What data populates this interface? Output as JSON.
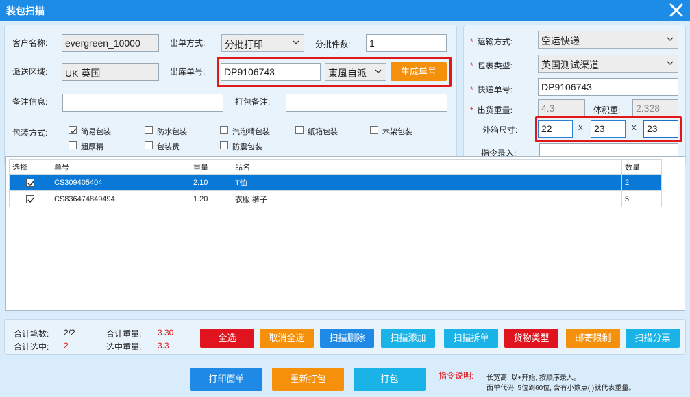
{
  "window": {
    "title": "装包扫描",
    "close_icon": "close-icon"
  },
  "form": {
    "customer_label": "客户名称:",
    "customer_value": "evergreen_10000",
    "order_method_label": "出单方式:",
    "order_method_value": "分批打印",
    "batch_count_label": "分批件数:",
    "batch_count_value": "1",
    "delivery_area_label": "派送区域:",
    "delivery_area_value": "UK 英国",
    "outbound_no_label": "出库单号:",
    "outbound_no_value": "DP9106743",
    "outbound_channel_value": "東風自派",
    "generate_button": "生成单号",
    "remark_label": "备注信息:",
    "remark_value": "",
    "pack_remark_label": "打包备注:",
    "pack_remark_value": "",
    "packing_label": "包装方式:",
    "packing_options": [
      {
        "label": "简易包装",
        "checked": true
      },
      {
        "label": "防水包装",
        "checked": false
      },
      {
        "label": "汽泡精包装",
        "checked": false
      },
      {
        "label": "纸箱包装",
        "checked": false
      },
      {
        "label": "木架包装",
        "checked": false
      },
      {
        "label": "超厚精",
        "checked": false
      },
      {
        "label": "包装费",
        "checked": false
      },
      {
        "label": "防震包装",
        "checked": false
      }
    ]
  },
  "shipping": {
    "required_mark": "*",
    "transport_label": "运输方式:",
    "transport_value": "空运快递",
    "package_type_label": "包裹类型:",
    "package_type_value": "英国测试渠道",
    "tracking_label": "快递单号:",
    "tracking_value": "DP9106743",
    "weight_label": "出货重量:",
    "weight_value": "4.3",
    "volume_weight_label": "体积重:",
    "volume_weight_value": "2.328",
    "dimensions_label": "外箱尺寸:",
    "dim_length": "22",
    "dim_width": "23",
    "dim_height": "23",
    "dim_sep": "X",
    "command_label": "指令录入:",
    "command_value": ""
  },
  "table": {
    "headers": [
      "选择",
      "单号",
      "重量",
      "品名",
      "数量"
    ],
    "rows": [
      {
        "checked": true,
        "order_no": "CS309405404",
        "weight": "2.10",
        "name": "T恤",
        "qty": "2",
        "selected": true
      },
      {
        "checked": true,
        "order_no": "CS836474849494",
        "weight": "1.20",
        "name": "衣服,裤子",
        "qty": "5",
        "selected": false
      }
    ]
  },
  "summary": {
    "total_count_label": "合计笔数:",
    "total_count_value": "2/2",
    "total_weight_label": "合计重量:",
    "total_weight_value": "3.30",
    "selected_count_label": "合计选中:",
    "selected_count_value": "2",
    "selected_weight_label": "选中重量:",
    "selected_weight_value": "3.3"
  },
  "actions": {
    "select_all": "全选",
    "deselect_all": "取消全选",
    "scan_delete": "扫描删除",
    "scan_add": "扫描添加",
    "scan_split": "扫描拆单",
    "goods_type": "货物类型",
    "postal_limit": "邮寄限制",
    "scan_split_ticket": "扫描分票"
  },
  "footer": {
    "print_label": "打印面单",
    "reprint": "重新打包",
    "pack": "打包",
    "instructions_title": "指令说明:",
    "instruction_1": "长宽高: 以+开始, 按顺序录入。",
    "instruction_2": "面单代码: 5位到60位, 含有小数点(.)就代表重量。"
  },
  "colors": {
    "title_bar": "#1d8ce6",
    "button_red": "#e0141f",
    "button_orange": "#f5900b",
    "button_blue": "#1e8ae6",
    "button_cyan": "#19b3e8",
    "row_selected": "#0a78d7",
    "highlight_box": "#e01818"
  }
}
